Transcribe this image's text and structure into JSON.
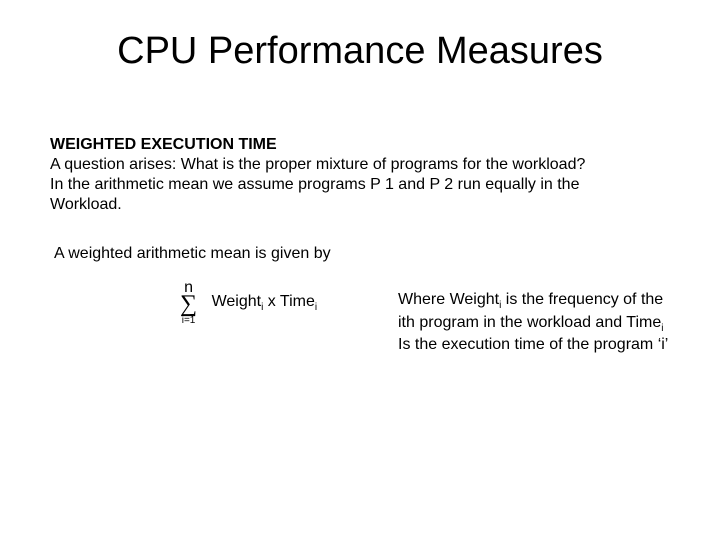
{
  "title": "CPU Performance Measures",
  "section_heading": "WEIGHTED EXECUTION TIME",
  "body_line1": "A question arises: What is the proper mixture of programs for the workload?",
  "body_line2": "In the arithmetic mean we assume programs P 1 and P 2 run equally in the",
  "body_line3": "Workload.",
  "lead": "A weighted arithmetic mean is given by",
  "sigma": {
    "upper": "n",
    "symbol": "∑",
    "lower": "i=1"
  },
  "formula": {
    "w": "Weight",
    "w_sub": "i",
    "mult": " x ",
    "t": "Time",
    "t_sub": "i"
  },
  "explain": {
    "p1a": "Where Weight",
    "p1a_sub": "i",
    "p1b": " is the frequency of the",
    "p2a": "ith program in the workload and Time",
    "p2a_sub": "i",
    "p3": "Is the execution time of the program ‘i’"
  }
}
